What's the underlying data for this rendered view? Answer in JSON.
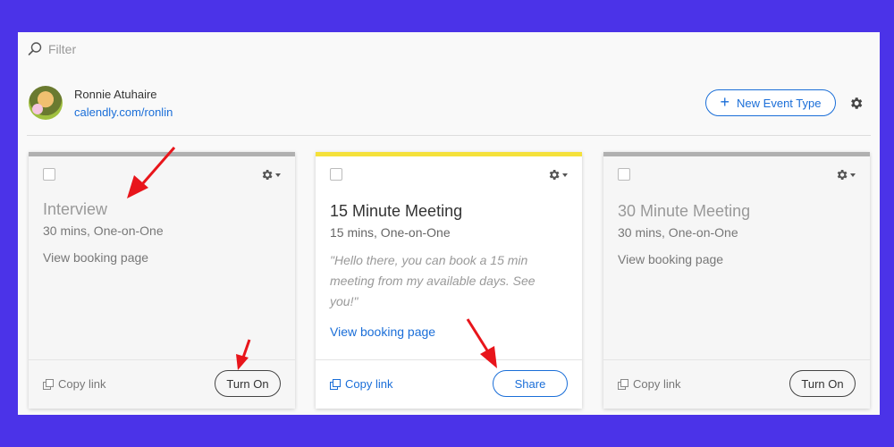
{
  "filter": {
    "placeholder": "Filter"
  },
  "profile": {
    "name": "Ronnie Atuhaire",
    "link": "calendly.com/ronlin"
  },
  "header": {
    "new_event_label": "New Event Type"
  },
  "cards": [
    {
      "title": "Interview",
      "meta": "30 mins, One-on-One",
      "view_booking": "View booking page",
      "copy_link": "Copy link",
      "action": "Turn On",
      "status": "off",
      "bar_color": "#b0b0b0"
    },
    {
      "title": "15 Minute Meeting",
      "meta": "15 mins, One-on-One",
      "description": "\"Hello there, you can book a 15 min meeting from my available days. See you!\"",
      "view_booking": "View booking page",
      "copy_link": "Copy link",
      "action": "Share",
      "status": "on",
      "bar_color": "#f5e13a"
    },
    {
      "title": "30 Minute Meeting",
      "meta": "30 mins, One-on-One",
      "view_booking": "View booking page",
      "copy_link": "Copy link",
      "action": "Turn On",
      "status": "off",
      "bar_color": "#b0b0b0"
    }
  ],
  "colors": {
    "accent": "#1a6ed8",
    "frame": "#4b33e8",
    "annotation": "#e8151b"
  },
  "icons": [
    "search-icon",
    "plus-icon",
    "gear-icon",
    "copy-link-icon",
    "chevron-down-icon",
    "avatar"
  ]
}
